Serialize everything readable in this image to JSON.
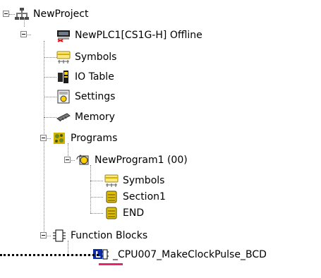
{
  "tree": {
    "project": "NewProject",
    "plc": "NewPLC1[CS1G-H] Offline",
    "plc_children": [
      "Symbols",
      "IO Table",
      "Settings",
      "Memory",
      "Programs"
    ],
    "program": "NewProgram1 (00)",
    "program_children": [
      "Symbols",
      "Section1",
      "END"
    ],
    "function_blocks": "Function Blocks",
    "function_block_item": "_CPU007_MakeClockPulse_BCD"
  },
  "colors": {
    "connector": "#808080",
    "highlight_underline": "#e8246c",
    "fb_icon_blue": "#0a2aa8"
  },
  "icons": {
    "project": "network-project-icon",
    "plc": "plc-offline-icon",
    "symbols": "symbols-icon",
    "io_table": "io-table-icon",
    "settings": "settings-icon",
    "memory": "memory-icon",
    "programs": "programs-icon",
    "program": "program-icon",
    "section": "section-icon",
    "end": "end-icon",
    "function_blocks": "function-blocks-icon",
    "function_block_item": "ladder-function-block-icon"
  }
}
